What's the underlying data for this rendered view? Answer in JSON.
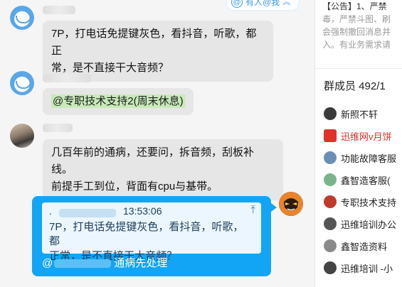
{
  "chat": {
    "at_me_label": "有人@我",
    "messages": [
      {
        "text_lines": [
          "7P，打电话免提键灰色，看抖音，听歌，都正",
          "常，是不直接干大音频？"
        ]
      },
      {
        "mention": "@专职技术支持2(周末休息)"
      },
      {
        "text_lines": [
          "几百年前的通病，还要问，拆音频，刮板补线。",
          "前提手工到位，背面有cpu与基带。"
        ]
      }
    ],
    "self_message": {
      "quote_time": "13:53:06",
      "quote_lines": [
        "7P，打电话免提键灰色，看抖音，听歌，都",
        "正常，是不直接干大音频？"
      ],
      "reply_prefix": "@",
      "reply_text": "通病先处理"
    }
  },
  "panel": {
    "notice_lines": [
      "【公告】1、严禁",
      "毒，严禁斗图、刷",
      "会强制撤回消息并",
      "入。有业务需求请"
    ],
    "members_title": "群成员 492/1",
    "members": [
      {
        "name": "新照不轩",
        "color": "#3a3a3a",
        "highlight": false
      },
      {
        "name": "迅维网v月饼",
        "color": "#e0302a",
        "highlight": true
      },
      {
        "name": "功能故障客服",
        "color": "#6a8fb5",
        "highlight": false
      },
      {
        "name": "鑫智造客服(",
        "color": "#7bb48c",
        "highlight": false
      },
      {
        "name": "专职技术支持",
        "color": "#c0392b",
        "highlight": false
      },
      {
        "name": "迅维培训办公",
        "color": "#555555",
        "highlight": false
      },
      {
        "name": "鑫智造资料",
        "color": "#8a8a8a",
        "highlight": false
      },
      {
        "name": "迅维培训 -小",
        "color": "#444444",
        "highlight": false
      }
    ]
  },
  "colors": {
    "self_bubble": "#12a5f5",
    "other_bubble": "#e6e6e6",
    "mention_bg": "#c7eab8",
    "accent": "#3b9be6"
  }
}
